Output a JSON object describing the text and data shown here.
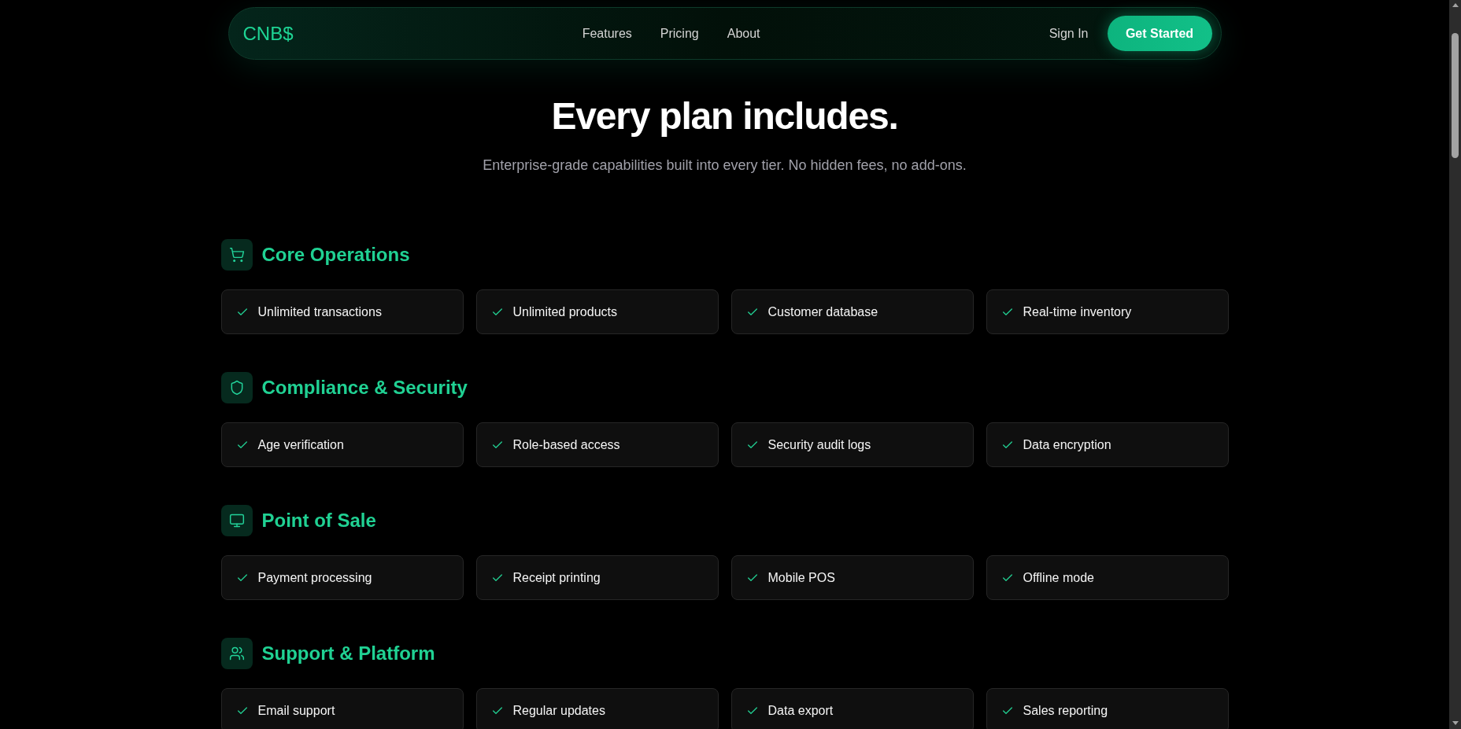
{
  "header": {
    "logo": "CNB$",
    "nav": [
      {
        "label": "Features"
      },
      {
        "label": "Pricing"
      },
      {
        "label": "About"
      }
    ],
    "sign_in": "Sign In",
    "cta": "Get Started"
  },
  "hero": {
    "title": "Every plan includes.",
    "subtitle": "Enterprise-grade capabilities built into every tier. No hidden fees, no add-ons."
  },
  "sections": [
    {
      "title": "Core Operations",
      "features": [
        "Unlimited transactions",
        "Unlimited products",
        "Customer database",
        "Real-time inventory"
      ]
    },
    {
      "title": "Compliance & Security",
      "features": [
        "Age verification",
        "Role-based access",
        "Security audit logs",
        "Data encryption"
      ]
    },
    {
      "title": "Point of Sale",
      "features": [
        "Payment processing",
        "Receipt printing",
        "Mobile POS",
        "Offline mode"
      ]
    },
    {
      "title": "Support & Platform",
      "features": [
        "Email support",
        "Regular updates",
        "Data export",
        "Sales reporting"
      ]
    }
  ]
}
